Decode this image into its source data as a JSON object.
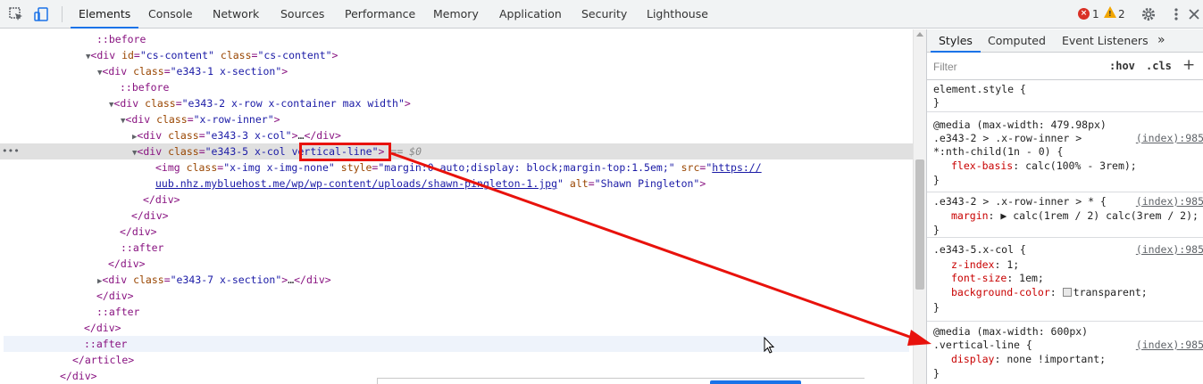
{
  "toolbar": {
    "tabs": [
      "Elements",
      "Console",
      "Network",
      "Sources",
      "Performance",
      "Memory",
      "Application",
      "Security",
      "Lighthouse"
    ],
    "error_count": "1",
    "warning_count": "2"
  },
  "tree": {
    "r0": "::before",
    "r1_tag": "<div",
    "r1_a1": "id",
    "r1_v1": "\"cs-content\"",
    "r1_a2": "class",
    "r1_v2": "\"cs-content\"",
    "r2_a": "class",
    "r2_v": "\"e343-1 x-section\"",
    "r3": "::before",
    "r4_a": "class",
    "r4_v": "\"e343-2 x-row x-container max width\"",
    "r5_a": "class",
    "r5_v": "\"x-row-inner\"",
    "r6_a": "class",
    "r6_v": "\"e343-3 x-col\"",
    "r7_a": "class",
    "r7_v1": "\"e343-5 x-col ",
    "r7_v2": "vertical-line",
    "r7_v3": "\"",
    "r7_eq": "== $0",
    "r8_a1": "class",
    "r8_v1": "\"x-img x-img-none\"",
    "r8_a2": "style",
    "r8_v2": "\"margin:0 auto;display: block;margin-top:1.5em;\"",
    "r8_a3": "src",
    "r8_link1": "https://",
    "r9_link2": "uub.nhz.mybluehost.me/wp/wp-content/uploads/shawn-pingleton-1.jpg",
    "r9_a": "alt",
    "r9_v": "\"Shawn Pingleton\"",
    "r14": "::after",
    "r16_a": "class",
    "r16_v": "\"e343-7 x-section\"",
    "r18": "::after",
    "r20": "::after",
    "r21": "</article>",
    "r22": "</div>"
  },
  "styles": {
    "tabs": [
      "Styles",
      "Computed",
      "Event Listeners"
    ],
    "more": "»",
    "filter_placeholder": "Filter",
    "hov": ":hov",
    "cls": ".cls",
    "plus": "+",
    "r1_sel": "element.style {",
    "close": "}",
    "r2_media": "@media (max-width: 479.98px)",
    "r2_sel1": ".e343-2 > .x-row-inner >",
    "r2_sel2": "*:nth-child(1n - 0) {",
    "r2_pn": "flex-basis",
    "r2_pv": ": calc(100% - 3rem);",
    "src": "(index):985",
    "r3_sel": ".e343-2 > .x-row-inner > * {",
    "r3_pn": "margin",
    "r3_pv": ": ▶ calc(1rem / 2) calc(3rem / 2);",
    "r4_sel": ".e343-5.x-col {",
    "r4_pn1": "z-index",
    "r4_pv1": ": 1;",
    "r4_pn2": "font-size",
    "r4_pv2": ": 1em;",
    "r4_pn3": "background-color",
    "r4_pv3": "transparent;",
    "r5_media": "@media (max-width: 600px)",
    "r5_sel": ".vertical-line {",
    "r5_pn": "display",
    "r5_pv": ": none !important;"
  },
  "colors": {
    "highlight": "#e8120c",
    "accent": "#1a73e8"
  }
}
